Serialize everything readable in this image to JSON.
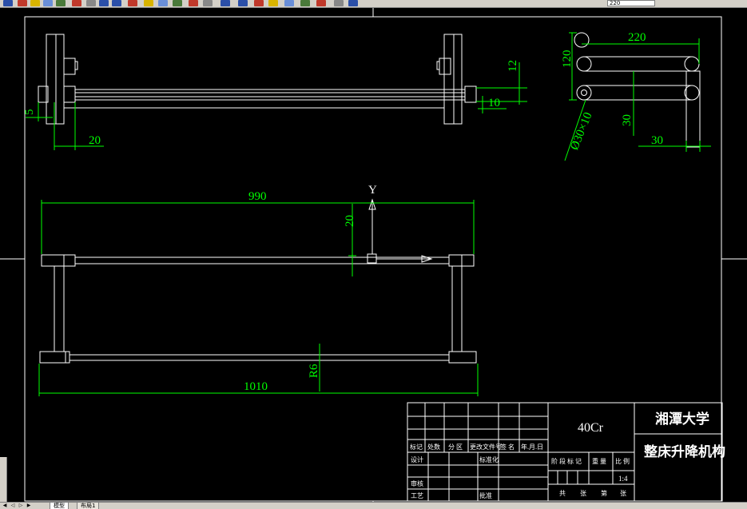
{
  "toolbar": {
    "zoom_value": "220",
    "buttons": [
      "open-icon",
      "save-icon",
      "print-icon",
      "preview-icon",
      "publish-icon",
      "cut-icon",
      "copy-icon",
      "paste-icon",
      "match-icon",
      "undo-icon",
      "redo-icon",
      "pan-icon",
      "zoom-realtime-icon",
      "zoom-window-icon",
      "zoom-previous-icon",
      "properties-icon",
      "designcenter-icon",
      "toolpalette-icon",
      "sheetset-icon",
      "markup-icon",
      "calc-icon",
      "help-icon",
      "layers-icon",
      "layer-state-icon"
    ],
    "colors": {
      "face": "#d4d0c8",
      "red": "#c0392b",
      "blue": "#2b4fa8",
      "yellow": "#d9b400"
    }
  },
  "tabs": {
    "model": "模型",
    "layout1": "布局1"
  },
  "drawing": {
    "colors": {
      "geometry": "#ffffff",
      "dimension": "#00ff00",
      "background": "#000000"
    },
    "front_view": {
      "dim_5": "5",
      "dim_20": "20",
      "dim_12": "12",
      "dim_10": "10"
    },
    "side_view": {
      "dim_220": "220",
      "dim_120": "120",
      "dim_30a": "30",
      "dim_30b": "30",
      "dim_tube": "Ø30×10"
    },
    "top_view": {
      "ucs_y": "Y",
      "dim_990": "990",
      "dim_20": "20",
      "dim_1010": "1010",
      "dim_r6": "R6"
    }
  },
  "title_block": {
    "material": "40Cr",
    "school": "湘潭大学",
    "drawing_name": "整床升降机构",
    "scale": "1:4",
    "headers": {
      "mark": "标记",
      "count": "处数",
      "zone": "分 区",
      "doc_no": "更改文件号",
      "sign": "签 名",
      "date": "年.月.日"
    },
    "design": "设计",
    "standard": "标准化",
    "check": "审核",
    "process": "工艺",
    "approve": "批准",
    "stage_header": {
      "stage": "阶 段 标 记",
      "weight": "重 量",
      "scale": "比 例"
    },
    "sheets": {
      "total": "共",
      "sheet_unit1": "张",
      "page": "第",
      "sheet_unit2": "张"
    }
  }
}
